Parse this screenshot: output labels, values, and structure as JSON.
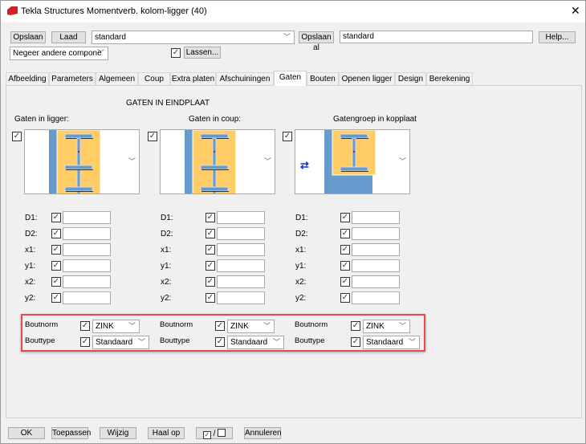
{
  "window": {
    "title": "Tekla Structures  Momentverb. kolom-ligger (40)",
    "close": "✕"
  },
  "toolbar": {
    "save": "Opslaan",
    "load": "Laad",
    "preset": "standard",
    "save_as": "Opslaan al",
    "save_as_value": "standard",
    "help": "Help...",
    "filter": "Negeer andere compone",
    "weld_checked": true,
    "welds": "Lassen..."
  },
  "tabs": [
    "Afbeelding",
    "Parameters",
    "Algemeen",
    "Coup",
    "Extra platen",
    "Afschuiningen",
    "Gaten",
    "Bouten",
    "Openen ligger",
    "Design",
    "Berekening"
  ],
  "active_tab": "Gaten",
  "section_title": "GATEN IN EINDPLAAT",
  "columns": [
    {
      "title": "Gaten in ligger:",
      "picture": "i-beam-full",
      "fields": [
        {
          "label": "D1:",
          "value": ""
        },
        {
          "label": "D2:",
          "value": ""
        },
        {
          "label": "x1:",
          "value": ""
        },
        {
          "label": "y1:",
          "value": ""
        },
        {
          "label": "x2:",
          "value": ""
        },
        {
          "label": "y2:",
          "value": ""
        }
      ],
      "boutnorm_label": "Boutnorm",
      "boutnorm": "ZINK",
      "bouttype_label": "Bouttype",
      "bouttype": "Standaard"
    },
    {
      "title": "Gaten in coup:",
      "picture": "i-beam-full",
      "fields": [
        {
          "label": "D1:",
          "value": ""
        },
        {
          "label": "D2:",
          "value": ""
        },
        {
          "label": "x1:",
          "value": ""
        },
        {
          "label": "y1:",
          "value": ""
        },
        {
          "label": "x2:",
          "value": ""
        },
        {
          "label": "y2:",
          "value": ""
        }
      ],
      "boutnorm_label": "Boutnorm",
      "boutnorm": "ZINK",
      "bouttype_label": "Bouttype",
      "bouttype": "Standaard"
    },
    {
      "title": "Gatengroep in kopplaat",
      "picture": "i-beam-top-swap",
      "fields": [
        {
          "label": "D1:",
          "value": ""
        },
        {
          "label": "D2:",
          "value": ""
        },
        {
          "label": "x1:",
          "value": ""
        },
        {
          "label": "y1:",
          "value": ""
        },
        {
          "label": "x2:",
          "value": ""
        },
        {
          "label": "y2:",
          "value": ""
        }
      ],
      "boutnorm_label": "Boutnorm",
      "boutnorm": "ZINK",
      "bouttype_label": "Bouttype",
      "bouttype": "Standaard"
    }
  ],
  "footer": {
    "ok": "OK",
    "apply": "Toepassen",
    "modify": "Wijzig",
    "get": "Haal op",
    "toggle": "/",
    "cancel": "Annuleren"
  },
  "colors": {
    "highlight": "#e8484e",
    "plate": "#ffcc66",
    "steel": "#6699cc"
  }
}
